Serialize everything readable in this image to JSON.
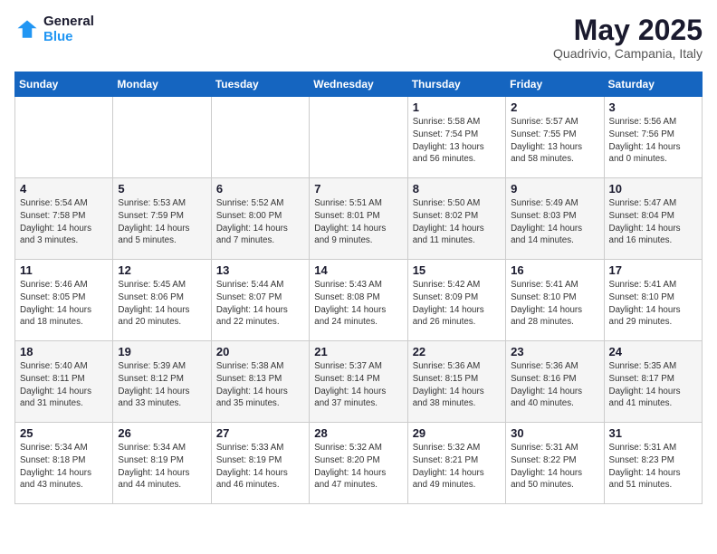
{
  "logo": {
    "general": "General",
    "blue": "Blue"
  },
  "title": "May 2025",
  "location": "Quadrivio, Campania, Italy",
  "days_of_week": [
    "Sunday",
    "Monday",
    "Tuesday",
    "Wednesday",
    "Thursday",
    "Friday",
    "Saturday"
  ],
  "weeks": [
    [
      {
        "day": "",
        "info": ""
      },
      {
        "day": "",
        "info": ""
      },
      {
        "day": "",
        "info": ""
      },
      {
        "day": "",
        "info": ""
      },
      {
        "day": "1",
        "info": "Sunrise: 5:58 AM\nSunset: 7:54 PM\nDaylight: 13 hours\nand 56 minutes."
      },
      {
        "day": "2",
        "info": "Sunrise: 5:57 AM\nSunset: 7:55 PM\nDaylight: 13 hours\nand 58 minutes."
      },
      {
        "day": "3",
        "info": "Sunrise: 5:56 AM\nSunset: 7:56 PM\nDaylight: 14 hours\nand 0 minutes."
      }
    ],
    [
      {
        "day": "4",
        "info": "Sunrise: 5:54 AM\nSunset: 7:58 PM\nDaylight: 14 hours\nand 3 minutes."
      },
      {
        "day": "5",
        "info": "Sunrise: 5:53 AM\nSunset: 7:59 PM\nDaylight: 14 hours\nand 5 minutes."
      },
      {
        "day": "6",
        "info": "Sunrise: 5:52 AM\nSunset: 8:00 PM\nDaylight: 14 hours\nand 7 minutes."
      },
      {
        "day": "7",
        "info": "Sunrise: 5:51 AM\nSunset: 8:01 PM\nDaylight: 14 hours\nand 9 minutes."
      },
      {
        "day": "8",
        "info": "Sunrise: 5:50 AM\nSunset: 8:02 PM\nDaylight: 14 hours\nand 11 minutes."
      },
      {
        "day": "9",
        "info": "Sunrise: 5:49 AM\nSunset: 8:03 PM\nDaylight: 14 hours\nand 14 minutes."
      },
      {
        "day": "10",
        "info": "Sunrise: 5:47 AM\nSunset: 8:04 PM\nDaylight: 14 hours\nand 16 minutes."
      }
    ],
    [
      {
        "day": "11",
        "info": "Sunrise: 5:46 AM\nSunset: 8:05 PM\nDaylight: 14 hours\nand 18 minutes."
      },
      {
        "day": "12",
        "info": "Sunrise: 5:45 AM\nSunset: 8:06 PM\nDaylight: 14 hours\nand 20 minutes."
      },
      {
        "day": "13",
        "info": "Sunrise: 5:44 AM\nSunset: 8:07 PM\nDaylight: 14 hours\nand 22 minutes."
      },
      {
        "day": "14",
        "info": "Sunrise: 5:43 AM\nSunset: 8:08 PM\nDaylight: 14 hours\nand 24 minutes."
      },
      {
        "day": "15",
        "info": "Sunrise: 5:42 AM\nSunset: 8:09 PM\nDaylight: 14 hours\nand 26 minutes."
      },
      {
        "day": "16",
        "info": "Sunrise: 5:41 AM\nSunset: 8:10 PM\nDaylight: 14 hours\nand 28 minutes."
      },
      {
        "day": "17",
        "info": "Sunrise: 5:41 AM\nSunset: 8:10 PM\nDaylight: 14 hours\nand 29 minutes."
      }
    ],
    [
      {
        "day": "18",
        "info": "Sunrise: 5:40 AM\nSunset: 8:11 PM\nDaylight: 14 hours\nand 31 minutes."
      },
      {
        "day": "19",
        "info": "Sunrise: 5:39 AM\nSunset: 8:12 PM\nDaylight: 14 hours\nand 33 minutes."
      },
      {
        "day": "20",
        "info": "Sunrise: 5:38 AM\nSunset: 8:13 PM\nDaylight: 14 hours\nand 35 minutes."
      },
      {
        "day": "21",
        "info": "Sunrise: 5:37 AM\nSunset: 8:14 PM\nDaylight: 14 hours\nand 37 minutes."
      },
      {
        "day": "22",
        "info": "Sunrise: 5:36 AM\nSunset: 8:15 PM\nDaylight: 14 hours\nand 38 minutes."
      },
      {
        "day": "23",
        "info": "Sunrise: 5:36 AM\nSunset: 8:16 PM\nDaylight: 14 hours\nand 40 minutes."
      },
      {
        "day": "24",
        "info": "Sunrise: 5:35 AM\nSunset: 8:17 PM\nDaylight: 14 hours\nand 41 minutes."
      }
    ],
    [
      {
        "day": "25",
        "info": "Sunrise: 5:34 AM\nSunset: 8:18 PM\nDaylight: 14 hours\nand 43 minutes."
      },
      {
        "day": "26",
        "info": "Sunrise: 5:34 AM\nSunset: 8:19 PM\nDaylight: 14 hours\nand 44 minutes."
      },
      {
        "day": "27",
        "info": "Sunrise: 5:33 AM\nSunset: 8:19 PM\nDaylight: 14 hours\nand 46 minutes."
      },
      {
        "day": "28",
        "info": "Sunrise: 5:32 AM\nSunset: 8:20 PM\nDaylight: 14 hours\nand 47 minutes."
      },
      {
        "day": "29",
        "info": "Sunrise: 5:32 AM\nSunset: 8:21 PM\nDaylight: 14 hours\nand 49 minutes."
      },
      {
        "day": "30",
        "info": "Sunrise: 5:31 AM\nSunset: 8:22 PM\nDaylight: 14 hours\nand 50 minutes."
      },
      {
        "day": "31",
        "info": "Sunrise: 5:31 AM\nSunset: 8:23 PM\nDaylight: 14 hours\nand 51 minutes."
      }
    ]
  ]
}
